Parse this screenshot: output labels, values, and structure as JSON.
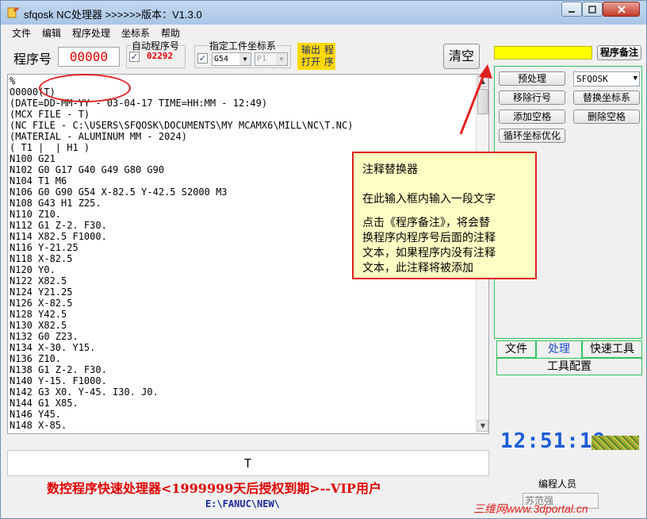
{
  "window": {
    "title": "sfqosk NC处理器 >>>>>>版本：V1.3.0"
  },
  "menu": [
    "文件",
    "编辑",
    "程序处理",
    "坐标系",
    "帮助"
  ],
  "toolbar": {
    "prog_label": "程序号",
    "prog_number": "00000",
    "auto_label": "自动程序号",
    "auto_checked": "✓",
    "auto_number": "02292",
    "coord_label": "指定工件坐标系",
    "coord_checked": "✓",
    "coord_value": "G54",
    "coord_sub_value": "P1",
    "btn_output_open": "输出\n打开",
    "btn_program": "程\n序",
    "clear_label": "清空",
    "note_input_value": "",
    "note_btn": "程序备注"
  },
  "editor": {
    "lines": [
      "%",
      "O0000(T)",
      "(DATE=DD-MM-YY - 03-04-17 TIME=HH:MM - 12:49)",
      "(MCX FILE - T)",
      "(NC FILE - C:\\USERS\\SFQOSK\\DOCUMENTS\\MY MCAMX6\\MILL\\NC\\T.NC)",
      "(MATERIAL - ALUMINUM MM - 2024)",
      "( T1 |  | H1 )",
      "N100 G21",
      "N102 G0 G17 G40 G49 G80 G90",
      "N104 T1 M6",
      "N106 G0 G90 G54 X-82.5 Y-42.5 S2000 M3",
      "N108 G43 H1 Z25.",
      "N110 Z10.",
      "N112 G1 Z-2. F30.",
      "N114 X82.5 F1000.",
      "N116 Y-21.25",
      "N118 X-82.5",
      "N120 Y0.",
      "N122 X82.5",
      "N124 Y21.25",
      "N126 X-82.5",
      "N128 Y42.5",
      "N130 X82.5",
      "N132 G0 Z23.",
      "N134 X-30. Y15.",
      "N136 Z10.",
      "N138 G1 Z-2. F30.",
      "N140 Y-15. F1000.",
      "N142 G3 X0. Y-45. I30. J0.",
      "N144 G1 X85.",
      "N146 Y45.",
      "N148 X-85."
    ],
    "sub_value": "T"
  },
  "status": {
    "license": "数控程序快速处理器<1999999天后授权到期>--VIP用户",
    "path": "E:\\FANUC\\NEW\\"
  },
  "right_panel": {
    "btn_preprocess": "预处理",
    "combo_value": "SFQOSK",
    "btn_remove_line": "移除行号",
    "btn_replace_coord": "替换坐标系",
    "btn_add_space": "添加空格",
    "btn_delete_space": "删除空格",
    "btn_loop_opt": "循环坐标优化",
    "tabs": [
      "文件",
      "处理",
      "快速工具"
    ],
    "active_tab": "处理",
    "tab_config": "工具配置",
    "clock": "12:51:19",
    "programmer_label": "编程人员",
    "programmer_value": "苏范强"
  },
  "callout": {
    "title": "注释替换器",
    "line1": "在此输入框内输入一段文字",
    "lines": [
      "点击《程序备注》，将会替",
      "换程序内程序号后面的注释",
      "文本，如果程序内没有注释",
      "文本，此注释将被添加"
    ]
  },
  "watermark": "三维网www.3dportal.cn",
  "colors": {
    "accent_red": "#e00000",
    "highlight_yellow": "#ffff00",
    "button_yellow": "#ffd800",
    "panel_green": "#2ec45a",
    "clock_blue": "#1a5bd8"
  }
}
